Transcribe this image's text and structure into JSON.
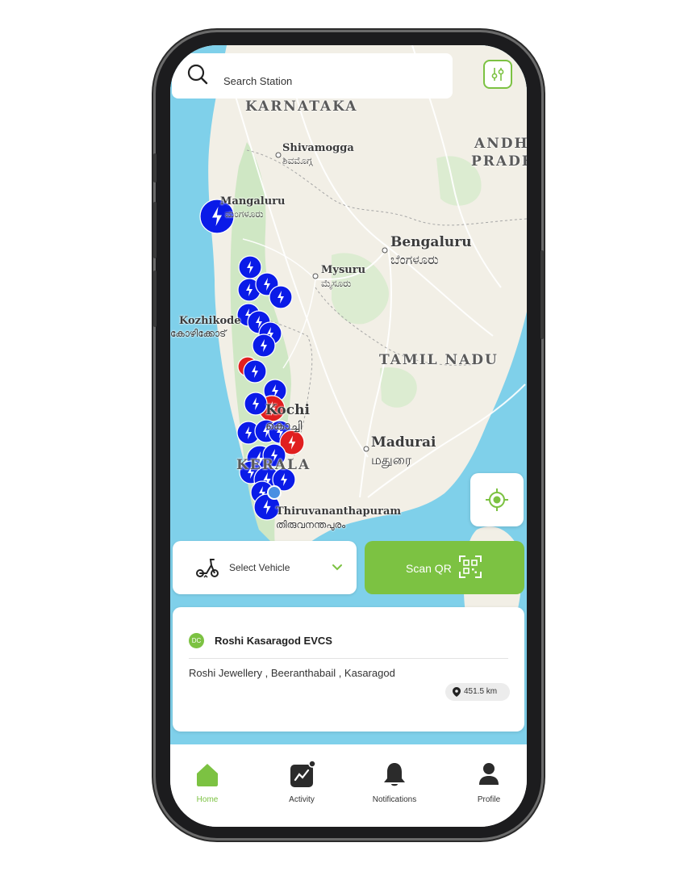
{
  "search": {
    "placeholder": "Search Station"
  },
  "map": {
    "region_labels": [
      "KARNATAKA",
      "ANDHR",
      "PRADE",
      "TAMIL NADU",
      "KERALA"
    ],
    "cities": [
      {
        "name": "Shivamogga",
        "native": "ಶಿವಮೊಗ್ಗ"
      },
      {
        "name": "Mangaluru",
        "native": "ಮಂಗಳೂರು"
      },
      {
        "name": "Bengaluru",
        "native": "ಬೆಂಗಳೂರು"
      },
      {
        "name": "Mysuru",
        "native": "ಮೈಸೂರು"
      },
      {
        "name": "Kozhikode",
        "native": "കോഴിക്കോട്"
      },
      {
        "name": "Kochi",
        "native": "കൊച്ചി"
      },
      {
        "name": "Madurai",
        "native": "மதுரை"
      },
      {
        "name": "Thiruvananthapuram",
        "native": "തിരുവനന്തപുരം"
      }
    ],
    "colors": {
      "water": "#7fd0ea",
      "land": "#f2efe6",
      "green": "#cfe7c4",
      "blue_marker": "#0a1be8",
      "red_marker": "#e01f1f",
      "accent": "#7cc242"
    }
  },
  "vehicle": {
    "label": "Select Vehicle",
    "icon": "scooter-icon"
  },
  "scan": {
    "label": "Scan QR",
    "icon": "qr-icon"
  },
  "station": {
    "badge": "DC",
    "name": "Roshi Kasaragod EVCS",
    "address": "Roshi Jewellery , Beeranthabail , Kasaragod",
    "distance": "451.5 km"
  },
  "nav": {
    "items": [
      {
        "label": "Home",
        "icon": "home-icon",
        "active": true
      },
      {
        "label": "Activity",
        "icon": "activity-icon",
        "active": false
      },
      {
        "label": "Notifications",
        "icon": "bell-icon",
        "active": false
      },
      {
        "label": "Profile",
        "icon": "profile-icon",
        "active": false
      }
    ]
  }
}
